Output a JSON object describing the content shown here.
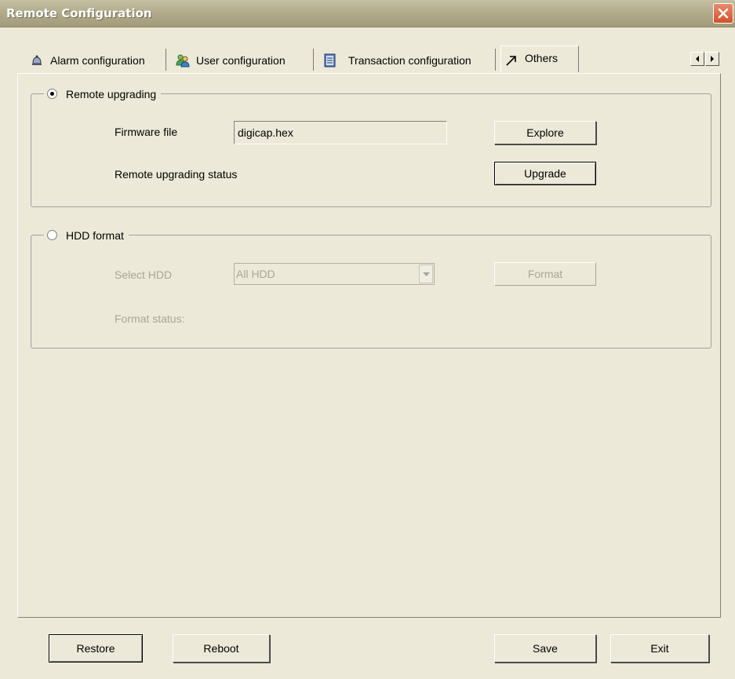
{
  "window": {
    "title": "Remote Configuration",
    "close_icon": "close-icon"
  },
  "tabs": [
    {
      "label": "Alarm configuration",
      "icon": "bell-icon",
      "active": false
    },
    {
      "label": "User configuration",
      "icon": "users-icon",
      "active": false
    },
    {
      "label": "Transaction configuration",
      "icon": "ledger-icon",
      "active": false
    },
    {
      "label": "Others",
      "icon": "arrow-icon",
      "active": true
    }
  ],
  "tab_scroll": {
    "left_icon": "scroll-left-icon",
    "right_icon": "scroll-right-icon"
  },
  "remote_upgrading": {
    "legend": "Remote upgrading",
    "selected": true,
    "firmware_label": "Firmware file",
    "firmware_value": "digicap.hex",
    "explore_label": "Explore",
    "status_label": "Remote upgrading status",
    "upgrade_label": "Upgrade"
  },
  "hdd_format": {
    "legend": "HDD format",
    "selected": false,
    "select_label": "Select HDD",
    "select_value": "All HDD",
    "format_label": "Format",
    "status_label": "Format status:"
  },
  "footer": {
    "restore_label": "Restore",
    "reboot_label": "Reboot",
    "save_label": "Save",
    "exit_label": "Exit"
  },
  "colors": {
    "background": "#ece9d8",
    "titlebar": "#b3ac8c",
    "close_button": "#d4502c",
    "disabled_text": "#a8a697"
  }
}
